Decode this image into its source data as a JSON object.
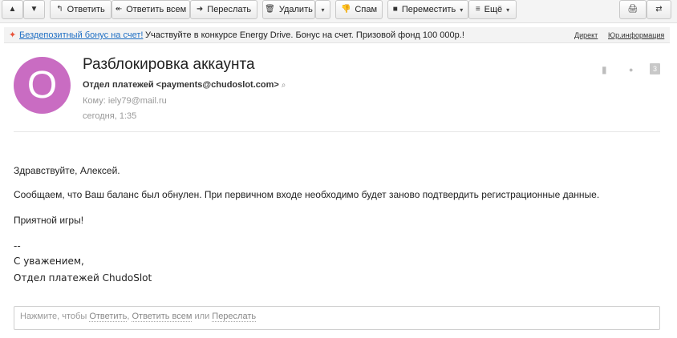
{
  "toolbar": {
    "up_glyph": "▲",
    "down_glyph": "▼",
    "reply": {
      "icon": "reply-icon",
      "glyph": "↰",
      "label": "Ответить"
    },
    "reply_all": {
      "icon": "reply-all-icon",
      "glyph": "↞",
      "label": "Ответить всем"
    },
    "forward": {
      "icon": "forward-arrow-icon",
      "glyph": "➜",
      "label": "Переслать"
    },
    "delete": {
      "icon": "trash-icon",
      "glyph": "🗑",
      "label": "Удалить"
    },
    "spam": {
      "icon": "thumbs-down-icon",
      "glyph": "👎",
      "label": "Спам"
    },
    "move": {
      "icon": "folder-icon",
      "glyph": "■",
      "label": "Переместить"
    },
    "more": {
      "icon": "menu-lines-icon",
      "glyph": "≡",
      "label": "Ещё"
    },
    "caret_glyph": "▾",
    "print_glyph": "🖨",
    "translate_glyph": "⇄"
  },
  "ad": {
    "link_text": "Бездепозитный бонус на счет!",
    "text": "Участвуйте в конкурсе Energy Drive. Бонус на счет. Призовой фонд 100 000р.!",
    "direct": "Директ",
    "legal": "Юр.информация",
    "flame_glyph": "✦"
  },
  "message": {
    "avatar_letter": "О",
    "subject": "Разблокировка аккаунта",
    "sender": "Отдел платежей <payments@chudoslot.com>",
    "sender_search_glyph": "⌕",
    "to": "Кому: iely79@mail.ru",
    "date": "сегодня, 1:35",
    "bookmark_glyph": "▮",
    "dot_glyph": "●",
    "count": "3",
    "body": {
      "greeting": "Здравствуйте, Алексей.",
      "para1": "Сообщаем, что Ваш баланс был обнулен. При первичном входе необходимо будет заново подтвердить регистрационные данные.",
      "para2": "Приятной игры!",
      "sig_sep": "--",
      "sig_regards": "С уважением,",
      "sig_dept": "Отдел платежей ChudoSlot"
    }
  },
  "reply_box": {
    "prompt": "Нажмите, чтобы ",
    "reply": "Ответить",
    "sep": ", ",
    "reply_all": "Ответить всем",
    "or": " или ",
    "forward": "Переслать"
  },
  "colors": {
    "avatar": "#c96cc2",
    "link": "#1f6fc4",
    "flame": "#e8533a"
  }
}
